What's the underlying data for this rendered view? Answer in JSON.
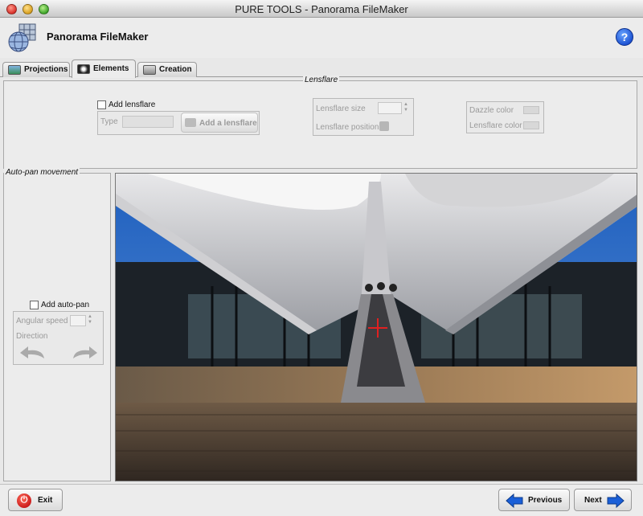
{
  "window": {
    "title": "PURE TOOLS - Panorama FileMaker"
  },
  "header": {
    "app_name": "Panorama FileMaker",
    "help_icon": "help-icon",
    "help_glyph": "?"
  },
  "tabs": [
    {
      "label": "Projections",
      "icon": "projections-icon",
      "active": false
    },
    {
      "label": "Elements",
      "icon": "elements-icon",
      "active": true
    },
    {
      "label": "Creation",
      "icon": "creation-icon",
      "active": false
    }
  ],
  "lensflare": {
    "legend": "Lensflare",
    "add_checkbox_label": "Add lensflare",
    "add_checked": false,
    "type_label": "Type",
    "add_button_label": "Add a lensflare",
    "size_label": "Lensflare size",
    "position_label": "Lensflare position",
    "dazzle_color_label": "Dazzle color",
    "lensflare_color_label": "Lensflare color"
  },
  "autopan": {
    "legend": "Auto-pan movement",
    "add_checkbox_label": "Add auto-pan",
    "add_checked": false,
    "angular_speed_label": "Angular speed",
    "direction_label": "Direction",
    "left_arrow_icon": "rotate-left-icon",
    "right_arrow_icon": "rotate-right-icon"
  },
  "footer": {
    "exit_label": "Exit",
    "previous_label": "Previous",
    "next_label": "Next"
  },
  "colors": {
    "accent_blue": "#1a5fd8",
    "exit_red": "#d8262a",
    "crosshair": "#e02020",
    "sky": "#2f6fc6"
  }
}
